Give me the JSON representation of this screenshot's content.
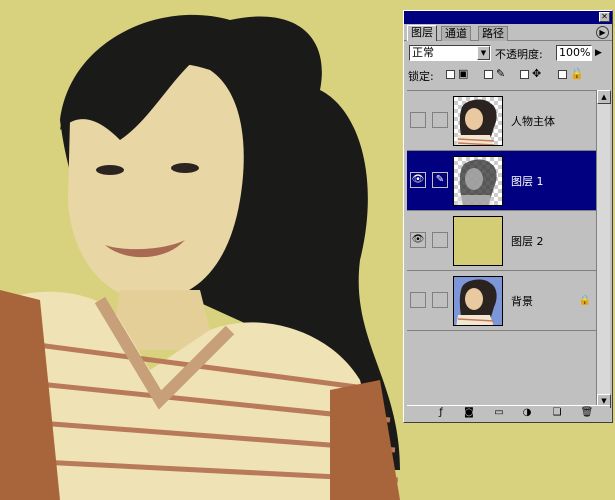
{
  "palette": {
    "tabs": [
      "图层",
      "通道",
      "路径"
    ],
    "blend_mode": "正常",
    "opacity_label": "不透明度:",
    "opacity_value": "100%",
    "lock_label": "锁定:",
    "layers": [
      {
        "name": "人物主体",
        "visible": false,
        "selected": false
      },
      {
        "name": "图层 1",
        "visible": true,
        "selected": true
      },
      {
        "name": "图层 2",
        "visible": true,
        "selected": false
      },
      {
        "name": "背景",
        "visible": false,
        "selected": false
      }
    ]
  },
  "colors": {
    "canvas_bg": "#d6d07a",
    "layer2_fill": "#d4cd76",
    "selected": "#000080"
  }
}
